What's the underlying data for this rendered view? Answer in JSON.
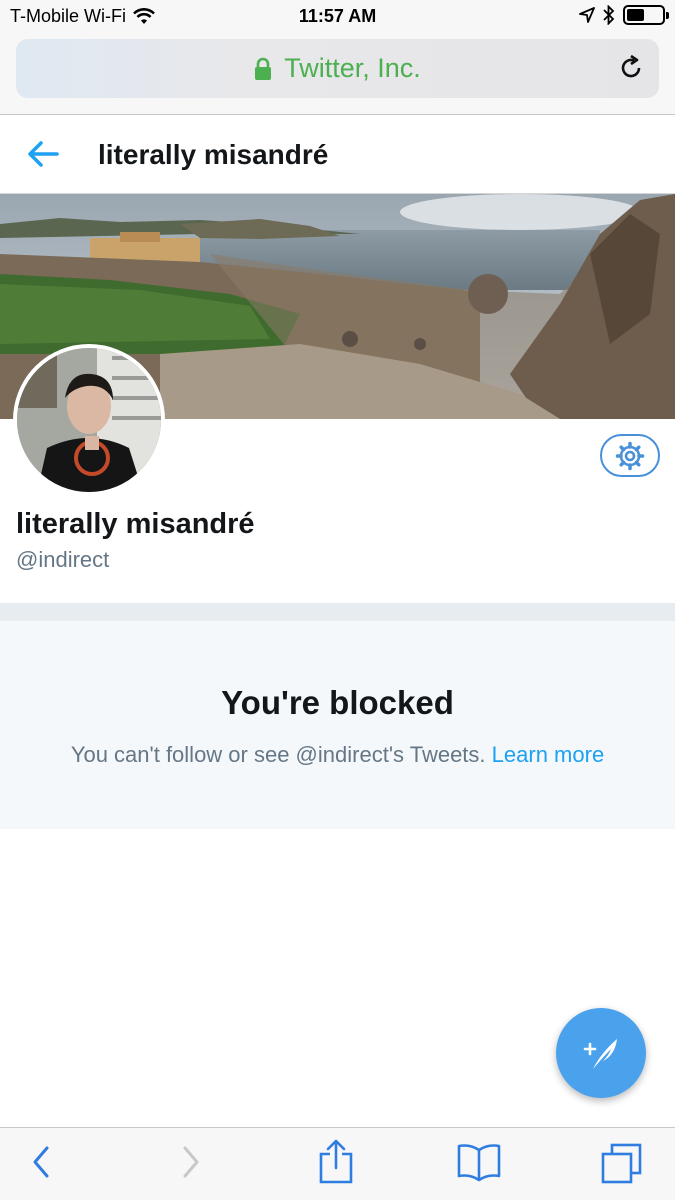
{
  "status_bar": {
    "carrier": "T-Mobile Wi-Fi",
    "time": "11:57 AM"
  },
  "address_bar": {
    "site": "Twitter, Inc."
  },
  "header": {
    "title": "literally misandré"
  },
  "profile": {
    "name": "literally misandré",
    "handle": "@indirect"
  },
  "blocked": {
    "title": "You're blocked",
    "message": "You can't follow or see @indirect's Tweets.",
    "link": "Learn more"
  },
  "colors": {
    "accent": "#1da1f2",
    "lock_green": "#4caf50",
    "fab": "#4aa1ec"
  },
  "icons": {
    "back": "arrow-left-icon",
    "settings": "gear-icon",
    "compose": "feather-plus-icon",
    "reload": "reload-icon",
    "lock": "lock-icon"
  }
}
